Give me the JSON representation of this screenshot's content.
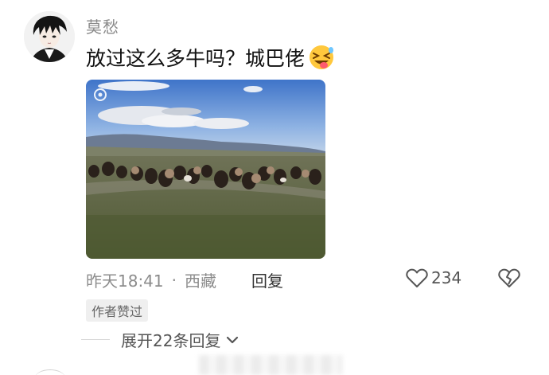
{
  "comment": {
    "username": "莫愁",
    "text": "放过这么多牛吗？城巴佬",
    "emoji_icon": "squinting-tongue-face-emoji",
    "time": "昨天18:41",
    "separator": "·",
    "location": "西藏",
    "reply_label": "回复",
    "like_count": "234",
    "author_liked_badge": "作者赞过",
    "expand_replies_label": "展开22条回复"
  },
  "colors": {
    "username": "#8a8a8a",
    "meta_text": "#8c8c8c",
    "badge_bg": "#efefef"
  }
}
